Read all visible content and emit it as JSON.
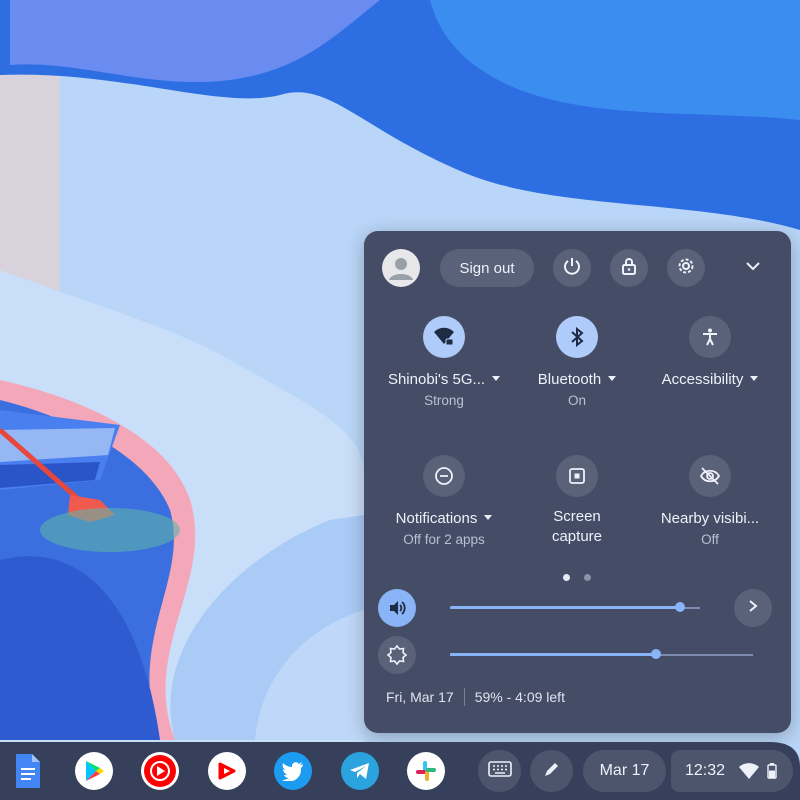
{
  "header": {
    "sign_out_label": "Sign out",
    "icons": [
      "avatar-icon",
      "power-icon",
      "lock-icon",
      "gear-icon",
      "chevron-down-icon"
    ]
  },
  "tiles": [
    {
      "label": "Shinobi's 5G...",
      "sub": "Strong",
      "icon": "wifi-locked-icon",
      "on": true,
      "dropdown": true
    },
    {
      "label": "Bluetooth",
      "sub": "On",
      "icon": "bluetooth-icon",
      "on": true,
      "dropdown": true
    },
    {
      "label": "Accessibility",
      "sub": "",
      "icon": "accessibility-icon",
      "on": false,
      "dropdown": true
    },
    {
      "label": "Notifications",
      "sub": "Off for 2 apps",
      "icon": "do-not-disturb-icon",
      "on": false,
      "dropdown": true
    },
    {
      "label": "Screen",
      "label2": "capture",
      "icon": "screen-capture-icon",
      "on": false,
      "dropdown": false
    },
    {
      "label": "Nearby visibi...",
      "sub": "Off",
      "icon": "visibility-off-icon",
      "on": false,
      "dropdown": false
    }
  ],
  "pager": {
    "pages": 2,
    "current": 1
  },
  "sliders": {
    "volume": {
      "level": 0.92,
      "icon": "volume-icon"
    },
    "brightness": {
      "level": 0.68,
      "icon": "brightness-icon"
    }
  },
  "footer": {
    "date": "Fri, Mar 17",
    "battery": "59% - 4:09 left"
  },
  "shelf": {
    "apps": [
      "google-docs-icon",
      "google-play-icon",
      "youtube-music-icon",
      "youtube-icon",
      "twitter-icon",
      "telegram-icon",
      "slack-icon"
    ],
    "date_label": "Mar 17",
    "time_label": "12:32"
  },
  "colors": {
    "panel": "#454d66",
    "accent": "#aecbfa",
    "slider": "#8ab4f8"
  }
}
